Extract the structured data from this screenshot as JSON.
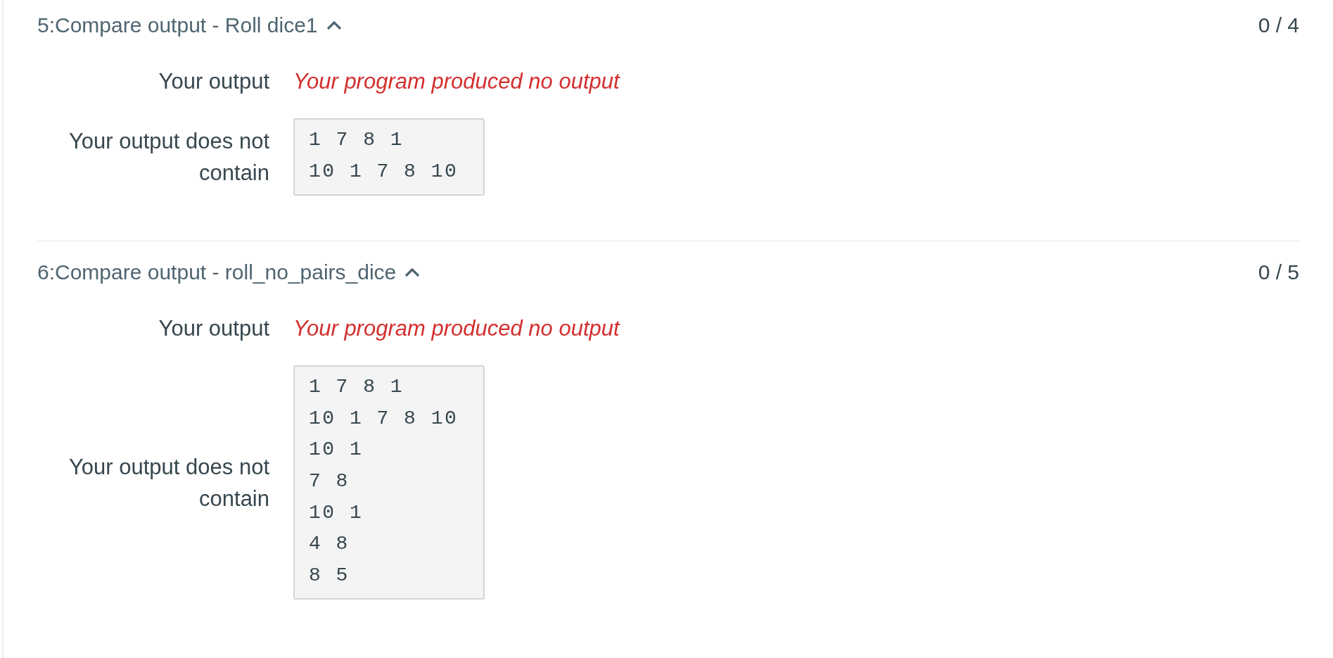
{
  "tests": [
    {
      "title": "5:Compare output - Roll dice1",
      "expanded": true,
      "score": "0 / 4",
      "rows": [
        {
          "kind": "message",
          "label": "Your output",
          "value": "Your program produced no output"
        },
        {
          "kind": "code",
          "label": "Your output does not contain",
          "lines": [
            "1 7 8 1",
            "10 1 7 8 10"
          ]
        }
      ]
    },
    {
      "title": "6:Compare output - roll_no_pairs_dice",
      "expanded": true,
      "score": "0 / 5",
      "rows": [
        {
          "kind": "message",
          "label": "Your output",
          "value": "Your program produced no output"
        },
        {
          "kind": "code",
          "label": "Your output does not contain",
          "lines": [
            "1 7 8 1",
            "10 1 7 8 10",
            "10 1",
            "7 8",
            "10 1",
            "4 8",
            "8 5"
          ]
        }
      ]
    }
  ]
}
